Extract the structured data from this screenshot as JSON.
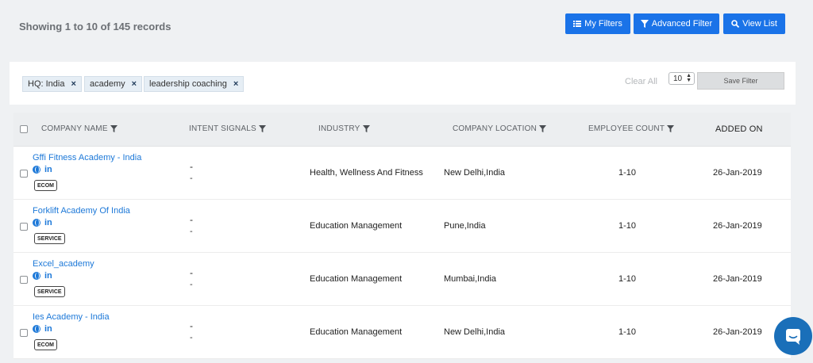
{
  "header": {
    "records_text": "Showing 1 to 10 of 145 records",
    "buttons": {
      "my_filters": "My Filters",
      "advanced_filter": "Advanced Filter",
      "view_list": "View List"
    }
  },
  "filters": {
    "chips": [
      "HQ: India",
      "academy",
      "leadership coaching"
    ],
    "remove_symbol": "×",
    "clear_all": "Clear All",
    "page_size": "10",
    "save_filter": "Save Filter"
  },
  "table": {
    "columns": {
      "company_name": "COMPANY NAME",
      "intent_signals": "INTENT SIGNALS",
      "industry": "INDUSTRY",
      "company_location": "COMPANY LOCATION",
      "employee_count": "EMPLOYEE COUNT",
      "added_on": "ADDED ON"
    },
    "rows": [
      {
        "name": "Gffi Fitness Academy - India",
        "tag": "ECOM",
        "intent_line1": "-",
        "intent_line2": "-",
        "industry": "Health, Wellness And Fitness",
        "location": "New Delhi,India",
        "employees": "1-10",
        "added_on": "26-Jan-2019"
      },
      {
        "name": "Forklift Academy Of India",
        "tag": "SERVICE",
        "intent_line1": "-",
        "intent_line2": "-",
        "industry": "Education Management",
        "location": "Pune,India",
        "employees": "1-10",
        "added_on": "26-Jan-2019"
      },
      {
        "name": "Excel_academy",
        "tag": "SERVICE",
        "intent_line1": "-",
        "intent_line2": "-",
        "industry": "Education Management",
        "location": "Mumbai,India",
        "employees": "1-10",
        "added_on": "26-Jan-2019"
      },
      {
        "name": "Ies Academy - India",
        "tag": "ECOM",
        "intent_line1": "-",
        "intent_line2": "-",
        "industry": "Education Management",
        "location": "New Delhi,India",
        "employees": "1-10",
        "added_on": "26-Jan-2019"
      }
    ],
    "linkedin_label": "in"
  },
  "icons": {
    "list": "list-icon",
    "filter": "filter-icon",
    "search": "search-icon",
    "globe": "globe-icon",
    "linkedin": "linkedin-icon",
    "chat": "chat-icon"
  },
  "colors": {
    "accent": "#1a73e8",
    "link": "#1c78d8",
    "chip_bg": "#e6eef5",
    "chat_bubble": "#1a6fb9"
  }
}
